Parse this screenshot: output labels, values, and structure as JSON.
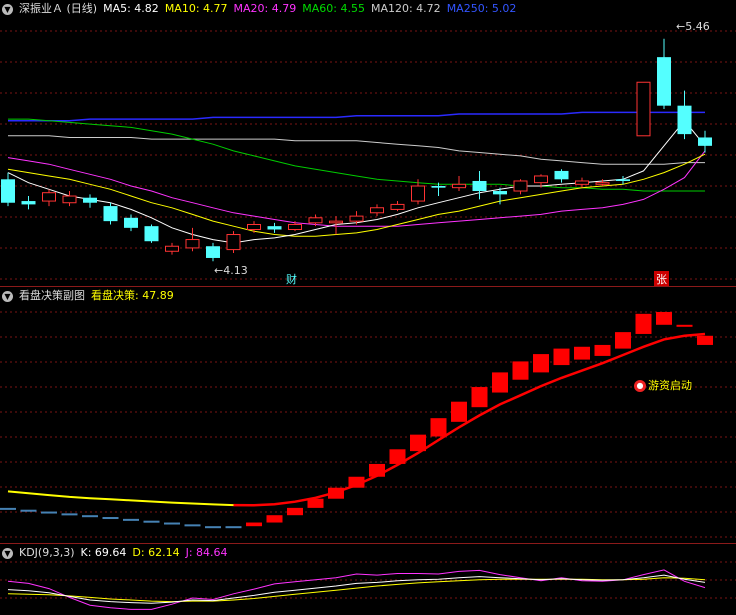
{
  "main": {
    "title": "深振业Ａ (日线)",
    "ma": [
      {
        "label": "MA5: 4.82",
        "color": "#ffffff"
      },
      {
        "label": "MA10: 4.77",
        "color": "#ffff00"
      },
      {
        "label": "MA20: 4.79",
        "color": "#ff33ff"
      },
      {
        "label": "MA60: 4.55",
        "color": "#00dd00"
      },
      {
        "label": "MA120: 4.72",
        "color": "#cccccc"
      },
      {
        "label": "MA250: 5.02",
        "color": "#3333ff"
      }
    ],
    "high_label": "5.46",
    "low_label": "4.13",
    "marker_cai": "财",
    "marker_zhang": "张"
  },
  "sub": {
    "title": "看盘决策副图",
    "indicator": "看盘决策: 47.89",
    "annotation": "游资启动"
  },
  "kdj": {
    "title": "KDJ(9,3,3)",
    "k": "K: 69.64",
    "d": "D: 62.14",
    "j": "J: 84.64"
  },
  "colors": {
    "up": "#ff3333",
    "down": "#54ffff",
    "grid": "#7a1515"
  },
  "chart_data": {
    "type": "candlestick",
    "candles": [
      {
        "o": 4.62,
        "c": 4.48,
        "h": 4.66,
        "l": 4.46
      },
      {
        "o": 4.49,
        "c": 4.47,
        "h": 4.52,
        "l": 4.44
      },
      {
        "o": 4.49,
        "c": 4.54,
        "h": 4.56,
        "l": 4.46
      },
      {
        "o": 4.48,
        "c": 4.52,
        "h": 4.55,
        "l": 4.46
      },
      {
        "o": 4.51,
        "c": 4.48,
        "h": 4.53,
        "l": 4.45
      },
      {
        "o": 4.46,
        "c": 4.37,
        "h": 4.48,
        "l": 4.35
      },
      {
        "o": 4.39,
        "c": 4.33,
        "h": 4.41,
        "l": 4.31
      },
      {
        "o": 4.34,
        "c": 4.25,
        "h": 4.35,
        "l": 4.24
      },
      {
        "o": 4.19,
        "c": 4.22,
        "h": 4.24,
        "l": 4.17
      },
      {
        "o": 4.21,
        "c": 4.26,
        "h": 4.33,
        "l": 4.19
      },
      {
        "o": 4.22,
        "c": 4.15,
        "h": 4.24,
        "l": 4.13
      },
      {
        "o": 4.2,
        "c": 4.29,
        "h": 4.31,
        "l": 4.18
      },
      {
        "o": 4.32,
        "c": 4.35,
        "h": 4.37,
        "l": 4.3
      },
      {
        "o": 4.34,
        "c": 4.32,
        "h": 4.36,
        "l": 4.3
      },
      {
        "o": 4.32,
        "c": 4.35,
        "h": 4.37,
        "l": 4.31
      },
      {
        "o": 4.36,
        "c": 4.39,
        "h": 4.41,
        "l": 4.34
      },
      {
        "o": 4.36,
        "c": 4.37,
        "h": 4.4,
        "l": 4.29
      },
      {
        "o": 4.37,
        "c": 4.4,
        "h": 4.43,
        "l": 4.35
      },
      {
        "o": 4.42,
        "c": 4.45,
        "h": 4.47,
        "l": 4.4
      },
      {
        "o": 4.44,
        "c": 4.47,
        "h": 4.49,
        "l": 4.43
      },
      {
        "o": 4.49,
        "c": 4.58,
        "h": 4.62,
        "l": 4.47
      },
      {
        "o": 4.58,
        "c": 4.57,
        "h": 4.6,
        "l": 4.52
      },
      {
        "o": 4.57,
        "c": 4.59,
        "h": 4.64,
        "l": 4.55
      },
      {
        "o": 4.61,
        "c": 4.55,
        "h": 4.67,
        "l": 4.5
      },
      {
        "o": 4.55,
        "c": 4.53,
        "h": 4.57,
        "l": 4.47
      },
      {
        "o": 4.55,
        "c": 4.61,
        "h": 4.62,
        "l": 4.53
      },
      {
        "o": 4.6,
        "c": 4.64,
        "h": 4.65,
        "l": 4.57
      },
      {
        "o": 4.67,
        "c": 4.62,
        "h": 4.68,
        "l": 4.6
      },
      {
        "o": 4.59,
        "c": 4.61,
        "h": 4.63,
        "l": 4.57
      },
      {
        "o": 4.59,
        "c": 4.6,
        "h": 4.62,
        "l": 4.58
      },
      {
        "o": 4.62,
        "c": 4.61,
        "h": 4.64,
        "l": 4.59
      },
      {
        "o": 4.88,
        "c": 5.2,
        "h": 5.2,
        "l": 4.88
      },
      {
        "o": 5.35,
        "c": 5.06,
        "h": 5.46,
        "l": 5.04
      },
      {
        "o": 5.06,
        "c": 4.89,
        "h": 5.15,
        "l": 4.86
      },
      {
        "o": 4.87,
        "c": 4.82,
        "h": 4.91,
        "l": 4.78
      }
    ],
    "decision_bars": [
      {
        "o": 11,
        "c": 12
      },
      {
        "o": 10,
        "c": 11
      },
      {
        "o": 9,
        "c": 10
      },
      {
        "o": 8,
        "c": 9
      },
      {
        "o": 7,
        "c": 8
      },
      {
        "o": 6,
        "c": 7
      },
      {
        "o": 5,
        "c": 6
      },
      {
        "o": 4,
        "c": 5
      },
      {
        "o": 3,
        "c": 4
      },
      {
        "o": 2,
        "c": 3
      },
      {
        "o": 1,
        "c": 2
      },
      {
        "o": 1,
        "c": 2
      },
      {
        "o": 2,
        "c": 4
      },
      {
        "o": 4,
        "c": 8
      },
      {
        "o": 8,
        "c": 12
      },
      {
        "o": 12,
        "c": 17
      },
      {
        "o": 17,
        "c": 23
      },
      {
        "o": 23,
        "c": 29
      },
      {
        "o": 29,
        "c": 36
      },
      {
        "o": 36,
        "c": 44
      },
      {
        "o": 43,
        "c": 52
      },
      {
        "o": 51,
        "c": 61
      },
      {
        "o": 59,
        "c": 70
      },
      {
        "o": 67,
        "c": 78
      },
      {
        "o": 75,
        "c": 86
      },
      {
        "o": 82,
        "c": 92
      },
      {
        "o": 86,
        "c": 96
      },
      {
        "o": 90,
        "c": 99
      },
      {
        "o": 93,
        "c": 100
      },
      {
        "o": 95,
        "c": 101
      },
      {
        "o": 99,
        "c": 108
      },
      {
        "o": 107,
        "c": 118
      },
      {
        "o": 112,
        "c": 119
      },
      {
        "o": 111,
        "c": 112
      },
      {
        "o": 101,
        "c": 106
      }
    ],
    "decision_line": [
      21,
      20,
      19,
      18,
      17.3,
      16.7,
      16.1,
      15.5,
      14.9,
      14.4,
      13.9,
      13.5,
      13.4,
      14,
      15.4,
      17.5,
      20.5,
      24.5,
      29.5,
      35.5,
      42,
      49,
      56,
      62.5,
      68.5,
      73.5,
      78.5,
      83,
      87,
      91,
      95.5,
      100,
      104,
      106,
      107
    ],
    "kdj_k": [
      38,
      36,
      32,
      25,
      18,
      15,
      13,
      12,
      14,
      18,
      17,
      22,
      27,
      33,
      37,
      41,
      45,
      50,
      52,
      55,
      57,
      58,
      61,
      63,
      61,
      59,
      57,
      59,
      57,
      56,
      57,
      61,
      66,
      58,
      52
    ],
    "kdj_d": [
      30,
      29,
      28,
      26,
      23,
      20,
      18,
      16,
      15,
      16,
      16,
      18,
      21,
      25,
      29,
      33,
      37,
      41,
      45,
      48,
      51,
      53,
      55,
      57,
      58,
      58,
      58,
      58,
      58,
      57,
      57,
      58,
      61,
      60,
      57
    ],
    "kdj_j": [
      54,
      50,
      40,
      23,
      8,
      3,
      0,
      0,
      10,
      22,
      19,
      30,
      39,
      49,
      53,
      57,
      61,
      68,
      66,
      69,
      69,
      68,
      73,
      75,
      67,
      61,
      55,
      61,
      55,
      54,
      57,
      67,
      76,
      54,
      42
    ],
    "ma5": [
      4.66,
      4.6,
      4.56,
      4.52,
      4.5,
      4.48,
      4.44,
      4.39,
      4.33,
      4.29,
      4.26,
      4.24,
      4.26,
      4.27,
      4.29,
      4.32,
      4.35,
      4.36,
      4.38,
      4.41,
      4.45,
      4.48,
      4.51,
      4.54,
      4.56,
      4.58,
      4.58,
      4.59,
      4.6,
      4.61,
      4.62,
      4.67,
      4.82,
      4.97,
      4.82
    ],
    "ma10": [
      4.68,
      4.66,
      4.64,
      4.62,
      4.59,
      4.56,
      4.52,
      4.48,
      4.45,
      4.41,
      4.37,
      4.34,
      4.31,
      4.29,
      4.28,
      4.28,
      4.29,
      4.3,
      4.32,
      4.35,
      4.38,
      4.41,
      4.43,
      4.46,
      4.49,
      4.51,
      4.53,
      4.55,
      4.57,
      4.58,
      4.59,
      4.62,
      4.66,
      4.71,
      4.77
    ],
    "ma20": [
      4.75,
      4.73,
      4.71,
      4.68,
      4.65,
      4.62,
      4.58,
      4.55,
      4.51,
      4.48,
      4.45,
      4.42,
      4.4,
      4.38,
      4.36,
      4.35,
      4.34,
      4.34,
      4.34,
      4.34,
      4.35,
      4.36,
      4.37,
      4.38,
      4.39,
      4.4,
      4.41,
      4.43,
      4.44,
      4.45,
      4.47,
      4.5,
      4.56,
      4.63,
      4.79
    ],
    "ma60": [
      4.98,
      4.98,
      4.97,
      4.96,
      4.95,
      4.94,
      4.93,
      4.91,
      4.89,
      4.86,
      4.83,
      4.79,
      4.76,
      4.73,
      4.7,
      4.68,
      4.66,
      4.64,
      4.62,
      4.61,
      4.6,
      4.59,
      4.59,
      4.59,
      4.59,
      4.58,
      4.58,
      4.57,
      4.57,
      4.56,
      4.56,
      4.55,
      4.55,
      4.55,
      4.55
    ],
    "ma120": [
      4.88,
      4.88,
      4.88,
      4.87,
      4.87,
      4.87,
      4.87,
      4.86,
      4.86,
      4.86,
      4.86,
      4.86,
      4.86,
      4.86,
      4.85,
      4.85,
      4.85,
      4.85,
      4.84,
      4.83,
      4.82,
      4.81,
      4.79,
      4.78,
      4.77,
      4.76,
      4.74,
      4.73,
      4.72,
      4.71,
      4.71,
      4.71,
      4.71,
      4.72,
      4.72
    ],
    "ma250": [
      4.97,
      4.97,
      4.97,
      4.97,
      4.98,
      4.98,
      4.98,
      4.98,
      4.98,
      4.98,
      4.99,
      4.99,
      4.99,
      4.99,
      4.99,
      4.99,
      4.99,
      5.0,
      5.0,
      5.0,
      5.0,
      5.0,
      5.01,
      5.01,
      5.01,
      5.01,
      5.01,
      5.01,
      5.02,
      5.02,
      5.02,
      5.02,
      5.02,
      5.02,
      5.02
    ],
    "price_range": [
      4.09,
      5.56
    ],
    "decision_range": [
      -5,
      125
    ],
    "kdj_range": [
      -5,
      95
    ]
  }
}
